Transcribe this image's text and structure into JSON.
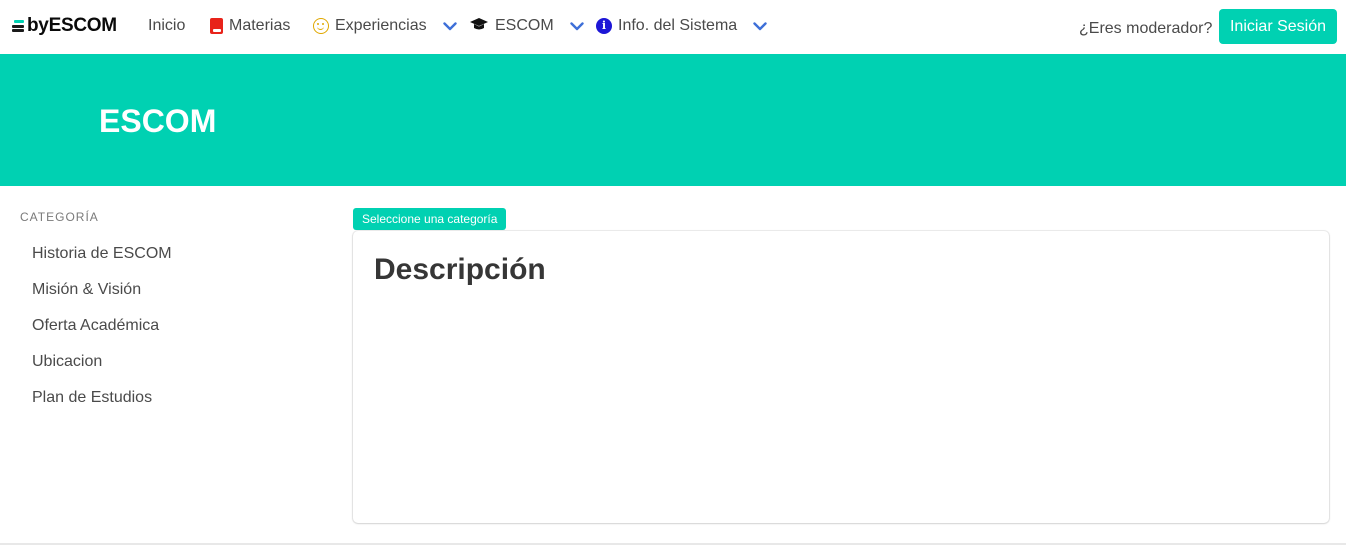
{
  "navbar": {
    "brand": "byESCOM",
    "items": [
      {
        "label": "Inicio",
        "icon": ""
      },
      {
        "label": "Materias",
        "icon": "book-icon"
      },
      {
        "label": "Experiencias",
        "icon": "smile-icon"
      },
      {
        "label": "ESCOM",
        "icon": "graduation-cap-icon"
      },
      {
        "label": "Info. del Sistema",
        "icon": "info-circle-icon"
      }
    ],
    "moderator_text": "¿Eres moderador?",
    "login_label": "Iniciar Sesión"
  },
  "hero": {
    "title": "ESCOM"
  },
  "sidebar": {
    "label": "CATEGORÍA",
    "items": [
      {
        "label": "Historia de ESCOM"
      },
      {
        "label": "Misión & Visión"
      },
      {
        "label": "Oferta Académica"
      },
      {
        "label": "Ubicacion"
      },
      {
        "label": "Plan de Estudios"
      }
    ]
  },
  "content": {
    "tag": "Seleccione una categoría",
    "title": "Descripción"
  },
  "colors": {
    "primary": "#00d1b2",
    "text": "#4a4a4a",
    "chevron": "#3e6fd8"
  }
}
